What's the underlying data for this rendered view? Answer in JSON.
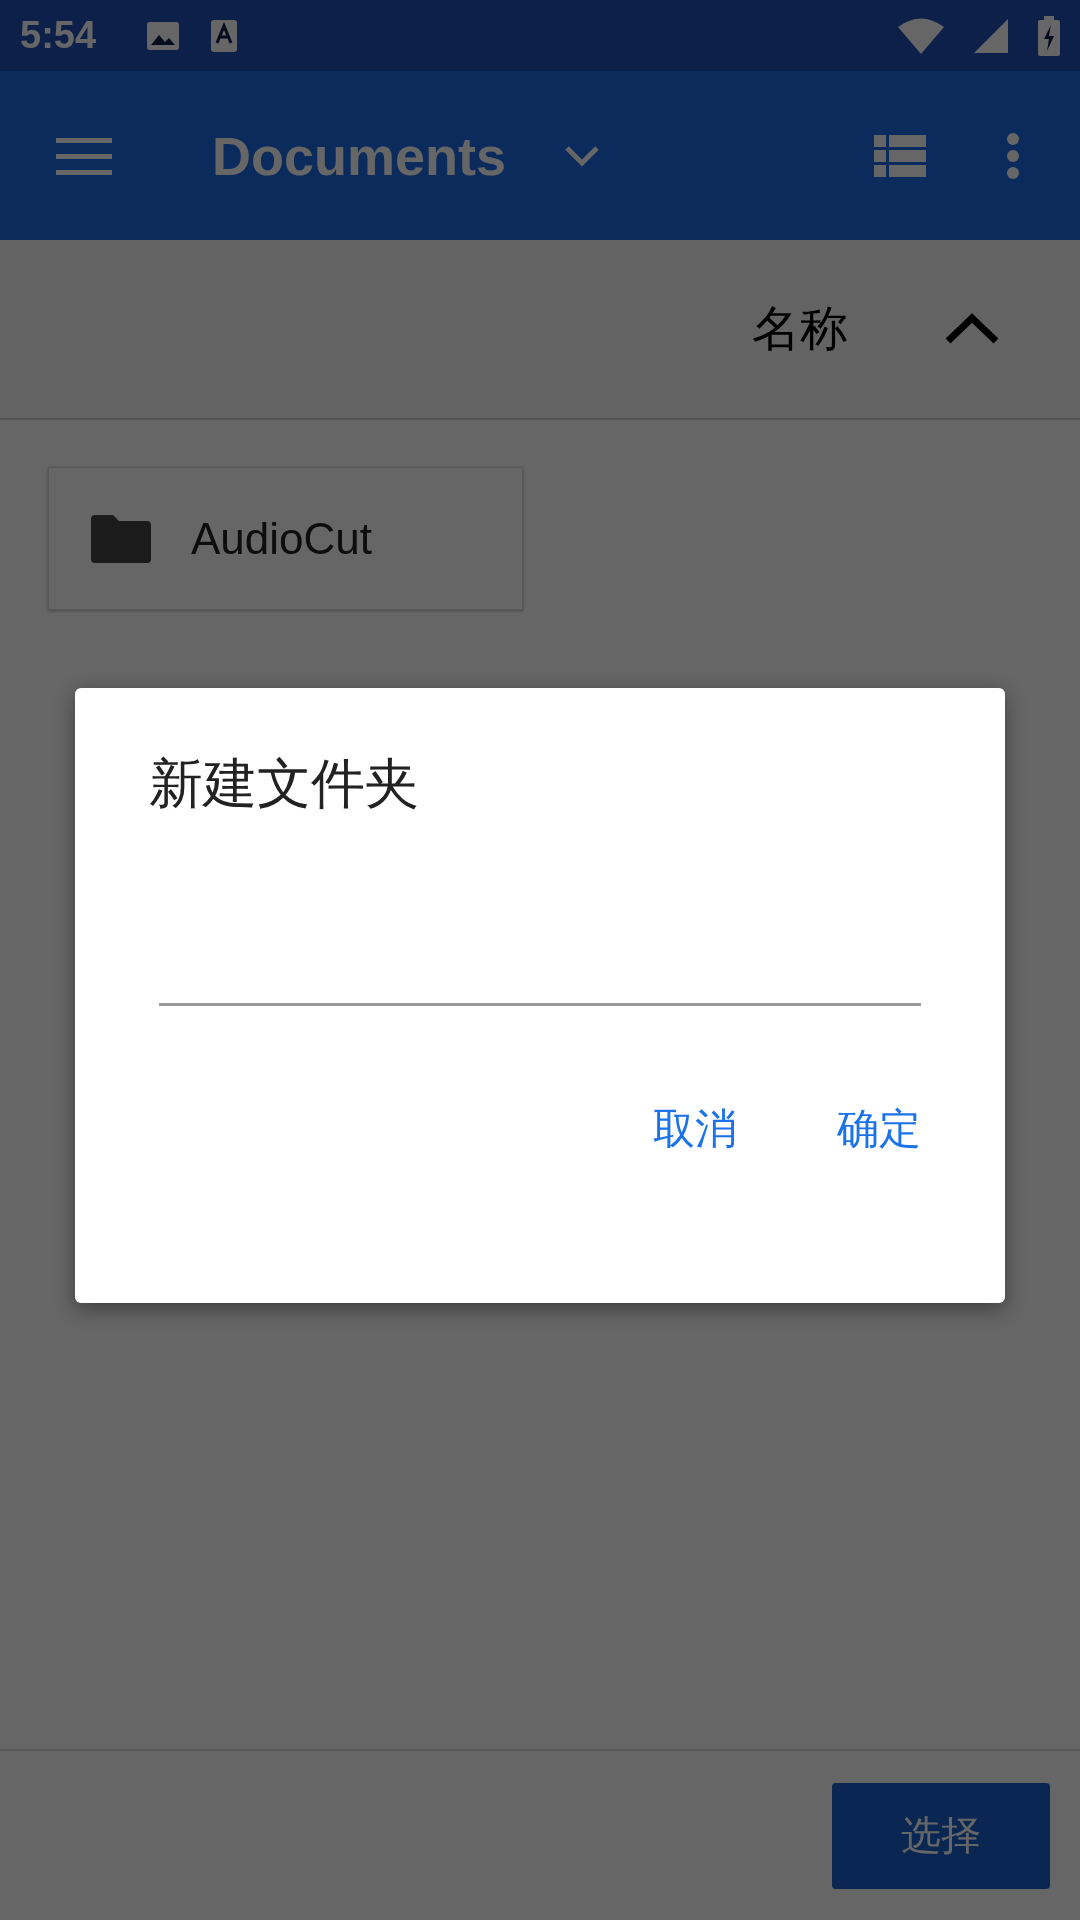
{
  "status_bar": {
    "time": "5:54"
  },
  "app_bar": {
    "title": "Documents"
  },
  "sort_bar": {
    "label": "名称"
  },
  "items": [
    {
      "name": "AudioCut"
    }
  ],
  "dialog": {
    "title": "新建文件夹",
    "buttons": [
      "取消",
      "确定"
    ]
  },
  "bottom_bar": {
    "button": "选择"
  }
}
